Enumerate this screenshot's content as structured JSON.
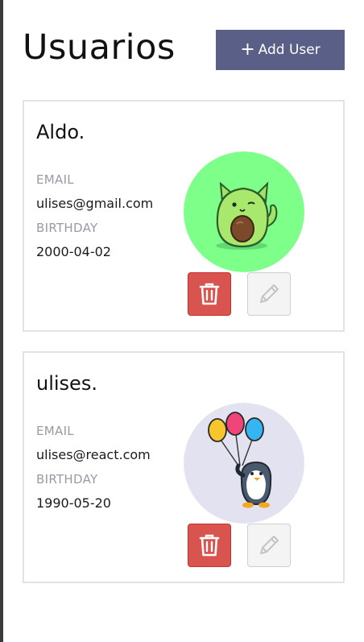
{
  "header": {
    "title": "Usuarios",
    "add_button": {
      "plus": "+",
      "label": "Add User"
    }
  },
  "colors": {
    "accent": "#5a5f87",
    "delete": "#d9534f",
    "label": "#9a9aa6",
    "card_border": "#e3e3e3"
  },
  "users": [
    {
      "name": "Aldo.",
      "email_label": "EMAIL",
      "email": "ulises@gmail.com",
      "birthday_label": "BIRTHDAY",
      "birthday": "2000-04-02",
      "avatar": "avocado-cat-avatar",
      "avatar_bg": "#7dff8a"
    },
    {
      "name": "ulises.",
      "email_label": "EMAIL",
      "email": "ulises@react.com",
      "birthday_label": "BIRTHDAY",
      "birthday": "1990-05-20",
      "avatar": "penguin-balloons-avatar",
      "avatar_bg": "#e3e2f0"
    }
  ],
  "icons": {
    "delete": "trash-icon",
    "edit": "pencil-icon"
  }
}
